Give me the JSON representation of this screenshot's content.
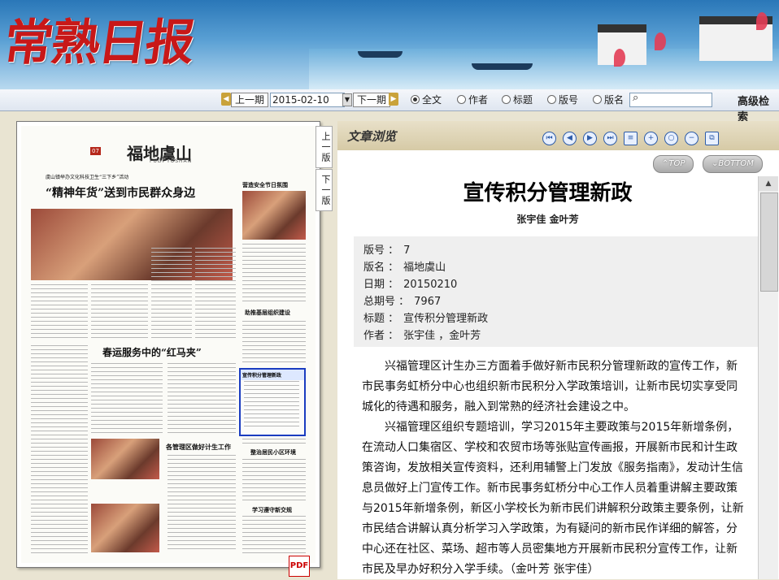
{
  "banner": {
    "logo": "常熟日报"
  },
  "nav": {
    "prev_label": "上一期",
    "next_label": "下一期",
    "date_value": "2015-02-10",
    "search_options": [
      {
        "label": "全文",
        "selected": true
      },
      {
        "label": "作者",
        "selected": false
      },
      {
        "label": "标题",
        "selected": false
      },
      {
        "label": "版号",
        "selected": false
      },
      {
        "label": "版名",
        "selected": false
      }
    ],
    "advanced_label": "高级检索"
  },
  "paper": {
    "page_num": "07",
    "page_name": "福地虞山",
    "page_name_en": "FUDI YUSHAN",
    "headline_main": "“精神年货”送到市民群众身边",
    "headline_kicker": "虞山镇举办文化科技卫生“三下乡”活动",
    "headline_2": "春运服务中的“红马夹”",
    "headline_3": "各管理区做好计生工作",
    "headline_4": "营造安全节日氛围",
    "headline_5": "助推基层组织建设",
    "headline_6": "整治居民小区环境",
    "headline_7": "学习遵守新交规",
    "highlight_title": "宣传积分管理新政",
    "prev_page_tab": "上一版",
    "next_page_tab": "下一版"
  },
  "reader": {
    "pane_title": "文章浏览",
    "tools": [
      "first-icon",
      "prev-icon",
      "next-icon",
      "last-icon",
      "list-icon",
      "zoom-in-icon",
      "zoom-reset-icon",
      "zoom-out-icon",
      "copy-icon"
    ],
    "top_label": "TOP",
    "bottom_label": "BOTTOM",
    "article": {
      "title": "宣传积分管理新政",
      "author": "张宇佳  金叶芳",
      "meta": [
        {
          "key": "版号",
          "value": "7"
        },
        {
          "key": "版名",
          "value": "福地虞山"
        },
        {
          "key": "日期",
          "value": "20150210"
        },
        {
          "key": "总期号",
          "value": "7967"
        },
        {
          "key": "标题",
          "value": "宣传积分管理新政"
        },
        {
          "key": "作者",
          "value": "张宇佳 ，金叶芳"
        }
      ],
      "paragraphs": [
        "兴福管理区计生办三方面着手做好新市民积分管理新政的宣传工作，新市民事务虹桥分中心也组织新市民积分入学政策培训，让新市民切实享受同城化的待遇和服务，融入到常熟的经济社会建设之中。",
        "兴福管理区组织专题培训，学习2015年主要政策与2015年新增条例，在流动人口集宿区、学校和农贸市场等张贴宣传画报，开展新市民和计生政策咨询，发放相关宣传资料，还利用辅警上门发放《服务指南》，发动计生信息员做好上门宣传工作。新市民事务虹桥分中心工作人员着重讲解主要政策与2015年新增条例，新区小学校长为新市民们讲解积分政策主要条例，让新市民结合讲解认真分析学习入学政策，为有疑问的新市民作详细的解答，分中心还在社区、菜场、超市等人员密集地方开展新市民积分宣传工作，让新市民及早办好积分入学手续。（金叶芳 张宇佳）"
      ]
    }
  }
}
